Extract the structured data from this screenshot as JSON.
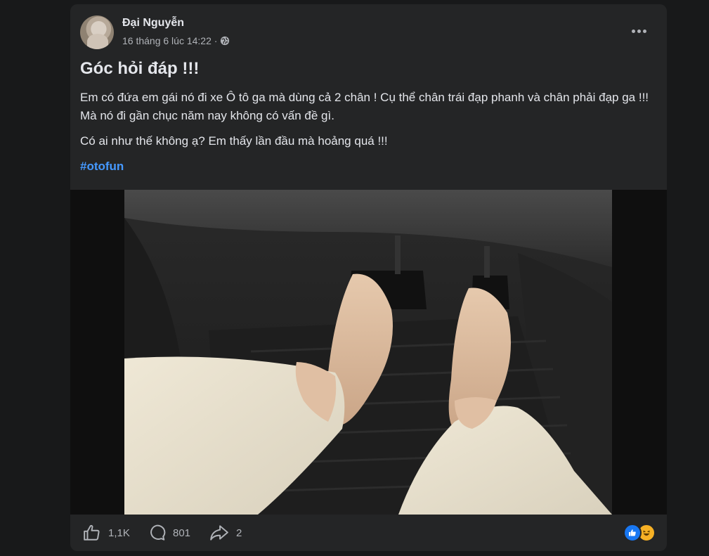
{
  "post": {
    "author": "Đại Nguyễn",
    "timestamp": "16 tháng 6 lúc 14:22 ·",
    "privacy_icon": "globe-icon",
    "more_icon": "more-options-icon",
    "title": "Góc hỏi đáp !!!",
    "paragraphs": [
      "Em có đứa em gái nó đi xe Ô tô ga mà dùng cả 2 chân ! Cụ thể chân trái đạp phanh và chân phải đạp ga !!! Mà nó đi gần chục năm nay không có vấn đề gì.",
      "Có ai như thế không ạ? Em thấy lần đầu mà hoảng quá !!!"
    ],
    "hashtag": "#otofun"
  },
  "footer": {
    "likes": "1,1K",
    "comments": "801",
    "shares": "2",
    "reactions": [
      "like",
      "haha"
    ]
  },
  "colors": {
    "background": "#18191a",
    "card": "#242526",
    "text": "#e4e6eb",
    "secondary": "#b0b3b8",
    "link": "#4599ff"
  }
}
